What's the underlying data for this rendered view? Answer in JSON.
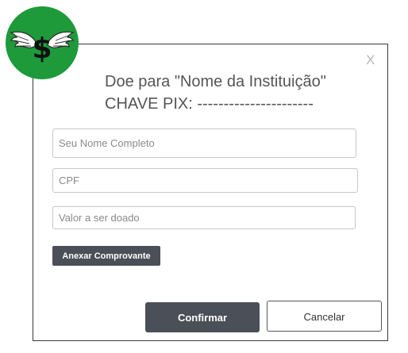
{
  "modal": {
    "title_line_1": "Doe para \"Nome da Instituição\"",
    "title_line_2": "CHAVE PIX: ----------------------",
    "close_label": "X"
  },
  "logo": {
    "icon": "winged-dollar-icon",
    "glyph": "$",
    "colors": {
      "circle": "#1e9a3a",
      "wings": "#ffffff",
      "symbol": "#111111"
    }
  },
  "form": {
    "name_placeholder": "Seu Nome Completo",
    "cpf_placeholder": "CPF",
    "value_placeholder": "Valor a ser doado",
    "attach_label": "Anexar Comprovante"
  },
  "actions": {
    "confirm_label": "Confirmar",
    "cancel_label": "Cancelar"
  },
  "colors": {
    "button_dark": "#4b4f57",
    "text_title": "#555555",
    "border": "#3a3a3a"
  }
}
